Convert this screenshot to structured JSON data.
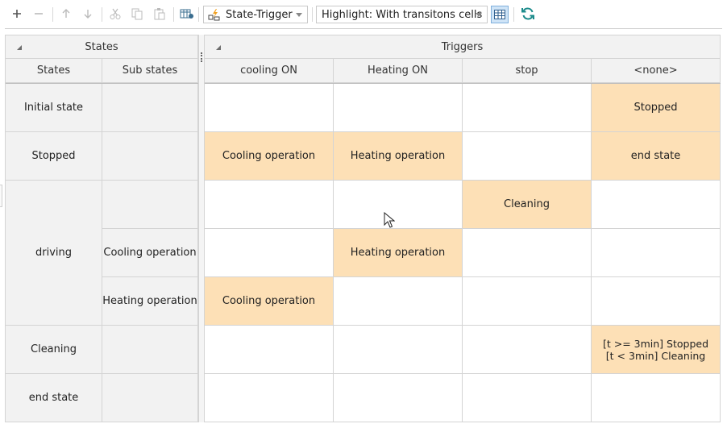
{
  "toolbar": {
    "icons": [
      "plus-icon",
      "minus-icon",
      "arrow-up-icon",
      "arrow-down-icon",
      "cut-icon",
      "copy-icon",
      "paste-icon",
      "table-settings-icon",
      "grid-view-icon",
      "refresh-icon"
    ],
    "view_combo": {
      "label": "State-Trigger",
      "icon": "state-trigger-icon"
    },
    "highlight_combo": {
      "label": "Highlight: With transitons cells"
    }
  },
  "states_group": {
    "title": "States",
    "columns": [
      "States",
      "Sub states"
    ]
  },
  "triggers_group": {
    "title": "Triggers",
    "columns": [
      "cooling ON",
      "Heating ON",
      "stop",
      "<none>"
    ]
  },
  "rows": [
    {
      "state": "Initial state",
      "substate": "",
      "cells": [
        "",
        "",
        "",
        "Stopped"
      ]
    },
    {
      "state": "Stopped",
      "substate": "",
      "cells": [
        "Cooling operation",
        "Heating operation",
        "",
        "end state"
      ]
    },
    {
      "state": "driving",
      "substate": "",
      "cells": [
        "",
        "",
        "Cleaning",
        ""
      ]
    },
    {
      "state": "",
      "substate": "Cooling operation",
      "cells": [
        "",
        "Heating operation",
        "",
        ""
      ]
    },
    {
      "state": "",
      "substate": "Heating operation",
      "cells": [
        "Cooling operation",
        "",
        "",
        ""
      ]
    },
    {
      "state": "Cleaning",
      "substate": "",
      "cells": [
        "",
        "",
        "",
        "[t >= 3min] Stopped\n[t < 3min] Cleaning"
      ]
    },
    {
      "state": "end state",
      "substate": "",
      "cells": [
        "",
        "",
        "",
        ""
      ]
    }
  ],
  "highlight_color": "#fde0b6"
}
